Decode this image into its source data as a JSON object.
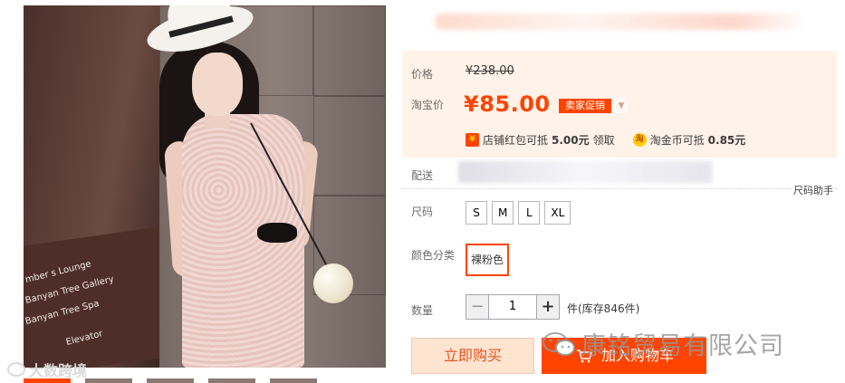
{
  "gallery": {
    "sign_lines": [
      "mber s Lounge",
      "Banyan Tree Gallery",
      "Banyan Tree Spa",
      "Elevator"
    ],
    "watermark_left": "大数跨境"
  },
  "price": {
    "label": "价格",
    "original": "¥238.00",
    "taobao_label": "淘宝价",
    "current": "¥85.00",
    "promo_badge": "卖家促销"
  },
  "coupons": {
    "red_packet_prefix": "店铺红包可抵",
    "red_packet_amount": "5.00元",
    "red_packet_action": "领取",
    "coin_prefix": "淘金币可抵",
    "coin_amount": "0.85元"
  },
  "delivery": {
    "label": "配送",
    "size_helper": "尺码助手"
  },
  "size": {
    "label": "尺码",
    "options": [
      "S",
      "M",
      "L",
      "XL"
    ]
  },
  "color": {
    "label": "颜色分类",
    "selected": "裸粉色"
  },
  "quantity": {
    "label": "数量",
    "value": "1",
    "minus": "−",
    "plus": "+",
    "stock": "件(库存846件)"
  },
  "actions": {
    "buy_now": "立即购买",
    "add_cart": "加入购物车"
  },
  "watermark_right": "康铭贸易有限公司",
  "colors": {
    "accent": "#ff4400",
    "price_bg": "#fff2e8"
  }
}
